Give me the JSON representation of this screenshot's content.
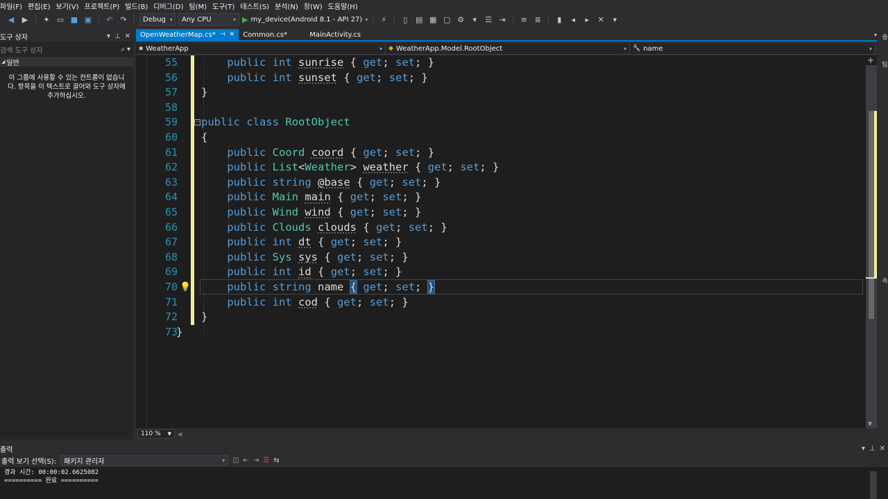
{
  "menu": [
    "파일(F)",
    "편집(E)",
    "보기(V)",
    "프로젝트(P)",
    "빌드(B)",
    "디버그(D)",
    "팀(M)",
    "도구(T)",
    "테스트(S)",
    "분석(N)",
    "창(W)",
    "도움말(H)"
  ],
  "toolbar": {
    "configuration": "Debug",
    "platform": "Any CPU",
    "run_target": "my_device(Android 8.1 - API 27)"
  },
  "toolbox": {
    "title": "도구 상자",
    "search_placeholder": "검색 도구 상자",
    "group": "일반",
    "empty_message": "이 그룹에 사용할 수 있는 컨트롤이 없습니다. 항목을 이 텍스트로 끌어와 도구 상자에 추가하십시오."
  },
  "tabs": [
    {
      "label": "OpenWeatherMap.cs*",
      "active": true
    },
    {
      "label": "Common.cs*",
      "active": false
    },
    {
      "label": "MainActivity.cs",
      "active": false
    }
  ],
  "navbar": {
    "project": "WeatherApp",
    "type": "WeatherApp.Model.RootObject",
    "member": "name"
  },
  "code": {
    "line_numbers": [
      "55",
      "56",
      "57",
      "58",
      "59",
      "60",
      "61",
      "62",
      "63",
      "64",
      "65",
      "66",
      "67",
      "68",
      "69",
      "70",
      "71",
      "72",
      "73"
    ],
    "current_line": "70"
  },
  "zoom": "110 %",
  "output": {
    "title": "출력",
    "show_from_label": "출력 보기 선택(S):",
    "show_from_value": "패키지 관리자",
    "lines": [
      "경과 시간: 00:00:02.6625082",
      "========== 완료 =========="
    ]
  },
  "colors": {
    "accent": "#007acc",
    "keyword": "#569cd6",
    "type": "#4ec9b0",
    "line_number": "#2b91af",
    "change_marker": "#efef9a"
  }
}
